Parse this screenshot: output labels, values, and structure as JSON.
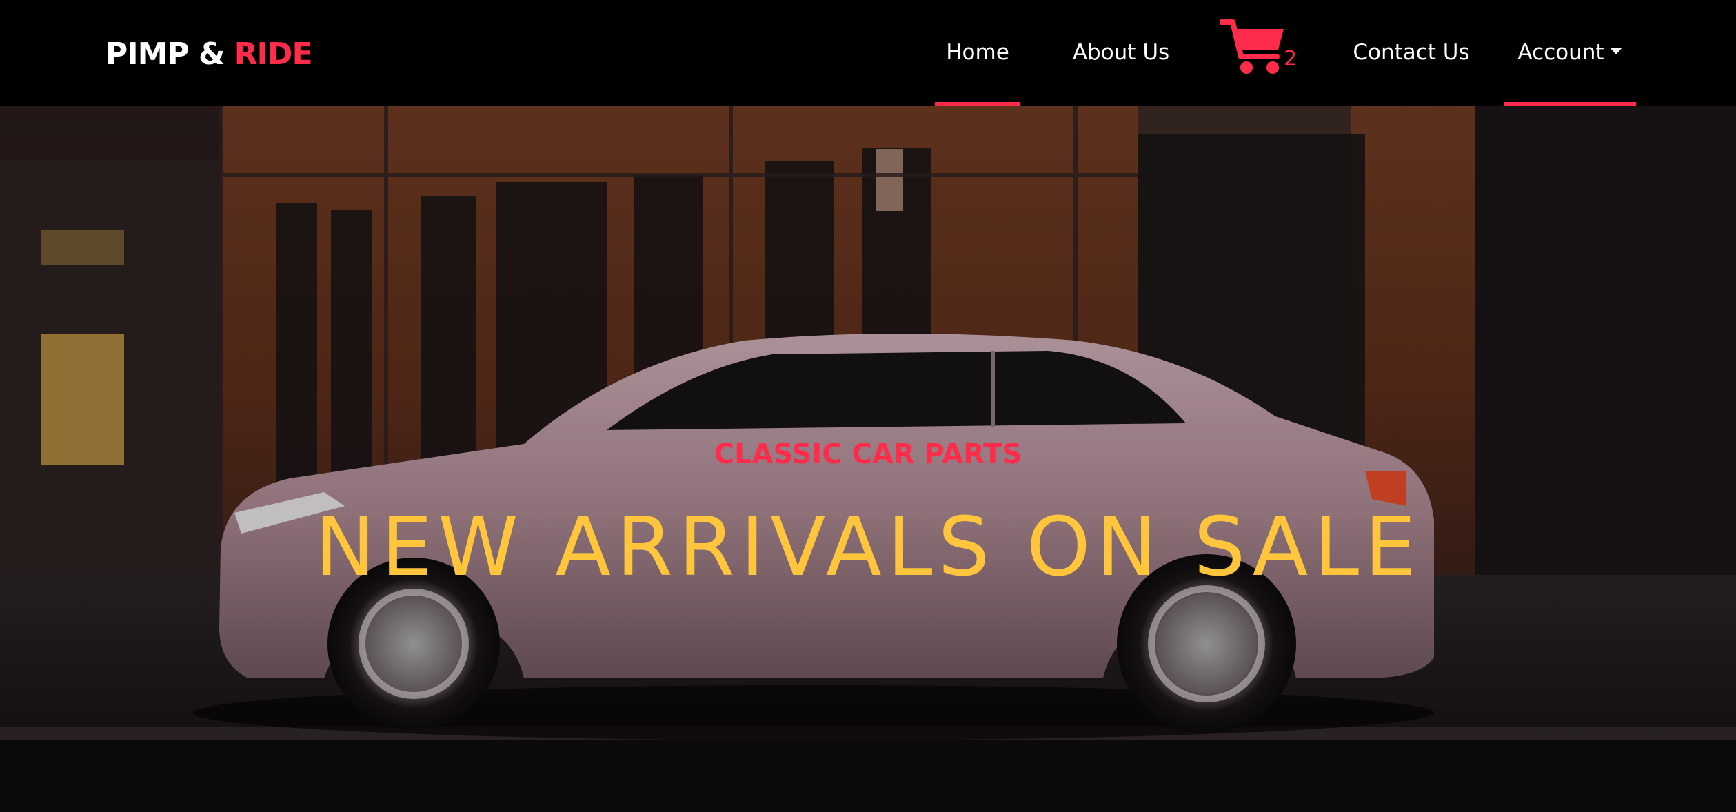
{
  "brand": {
    "part1": "PIMP & ",
    "part2": "RIDE"
  },
  "nav": {
    "home": "Home",
    "about": "About Us",
    "contact": "Contact Us",
    "account": "Account",
    "cart_count": "2"
  },
  "hero": {
    "subtitle": "CLASSIC CAR PARTS",
    "title": "NEW ARRIVALS ON SALE"
  },
  "colors": {
    "accent": "#ff2b4a",
    "title": "#ffc53d",
    "navbar_bg": "#000000"
  },
  "icons": {
    "cart": "shopping-cart-icon",
    "account_dropdown": "caret-down-icon"
  }
}
